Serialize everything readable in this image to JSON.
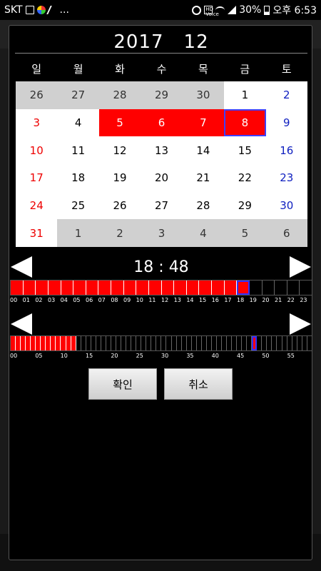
{
  "status_bar": {
    "carrier": "SKT",
    "more": "...",
    "battery": "30%",
    "time": "오후 6:53",
    "icons": [
      "image-icon",
      "app-icon",
      "feather-icon",
      "alarm-icon",
      "hd-voice-icon",
      "wifi-icon",
      "signal-icon",
      "battery-icon"
    ]
  },
  "calendar": {
    "year": "2017",
    "month": "12",
    "weekdays": [
      "일",
      "월",
      "화",
      "수",
      "목",
      "금",
      "토"
    ],
    "days": [
      {
        "d": "26",
        "other": true
      },
      {
        "d": "27",
        "other": true
      },
      {
        "d": "28",
        "other": true
      },
      {
        "d": "29",
        "other": true
      },
      {
        "d": "30",
        "other": true
      },
      {
        "d": "1"
      },
      {
        "d": "2"
      },
      {
        "d": "3"
      },
      {
        "d": "4"
      },
      {
        "d": "5",
        "selected": true
      },
      {
        "d": "6",
        "selected": true
      },
      {
        "d": "7",
        "selected": true
      },
      {
        "d": "8",
        "selected": true,
        "today": true
      },
      {
        "d": "9"
      },
      {
        "d": "10"
      },
      {
        "d": "11"
      },
      {
        "d": "12"
      },
      {
        "d": "13"
      },
      {
        "d": "14"
      },
      {
        "d": "15"
      },
      {
        "d": "16"
      },
      {
        "d": "17"
      },
      {
        "d": "18"
      },
      {
        "d": "19"
      },
      {
        "d": "20"
      },
      {
        "d": "21"
      },
      {
        "d": "22"
      },
      {
        "d": "23"
      },
      {
        "d": "24"
      },
      {
        "d": "25"
      },
      {
        "d": "26"
      },
      {
        "d": "27"
      },
      {
        "d": "28"
      },
      {
        "d": "29"
      },
      {
        "d": "30"
      },
      {
        "d": "31"
      },
      {
        "d": "1",
        "other": true
      },
      {
        "d": "2",
        "other": true
      },
      {
        "d": "3",
        "other": true
      },
      {
        "d": "4",
        "other": true
      },
      {
        "d": "5",
        "other": true
      },
      {
        "d": "6",
        "other": true
      }
    ],
    "colors": {
      "selected": "#ff0000",
      "sunday": "#e00000",
      "saturday": "#1020c0",
      "other_month_bg": "#d0d0d0"
    }
  },
  "time": {
    "display": "18 : 48",
    "hour_bar": {
      "segments": 24,
      "filled_through": 17,
      "current": 18,
      "labels": [
        "00",
        "01",
        "02",
        "03",
        "04",
        "05",
        "06",
        "07",
        "08",
        "09",
        "10",
        "11",
        "12",
        "13",
        "14",
        "15",
        "16",
        "17",
        "18",
        "19",
        "20",
        "21",
        "22",
        "23"
      ]
    },
    "minute_bar": {
      "segments": 60,
      "filled_through": 12,
      "current": 48,
      "labels": [
        "00",
        "05",
        "10",
        "15",
        "20",
        "25",
        "30",
        "35",
        "40",
        "45",
        "50",
        "55"
      ]
    }
  },
  "buttons": {
    "confirm": "확인",
    "cancel": "취소"
  }
}
